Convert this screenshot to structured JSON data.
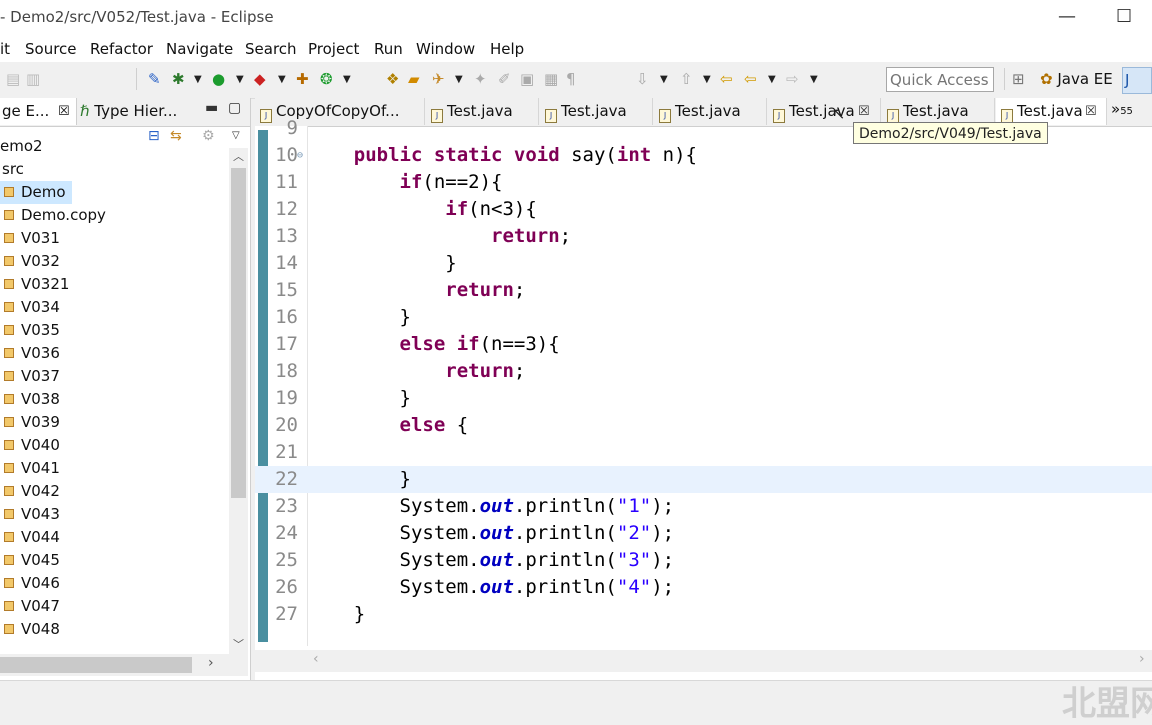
{
  "window": {
    "title": "- Demo2/src/V052/Test.java - Eclipse",
    "minimize_glyph": "—",
    "maximize_glyph": "☐"
  },
  "menubar": {
    "items": [
      "it",
      "Source",
      "Refactor",
      "Navigate",
      "Search",
      "Project",
      "Run",
      "Window",
      "Help"
    ]
  },
  "toolbar": {
    "quick_access_placeholder": "Quick Access",
    "perspective_javaee": "Java EE",
    "perspective_java": "J",
    "icons": [
      "debug-icon",
      "bug-icon",
      "run-icon",
      "coverage-icon",
      "new-class-icon",
      "external-tools-icon",
      "open-type-icon",
      "open-task-icon",
      "search-icon",
      "annotation-icon",
      "back-icon",
      "forward-icon"
    ]
  },
  "left_panel": {
    "tabs": [
      {
        "label": "ge E...",
        "close": "☒"
      },
      {
        "label": "Type Hier..."
      }
    ],
    "tree": [
      {
        "label": "emo2",
        "type": "project"
      },
      {
        "label": "src",
        "type": "folder"
      },
      {
        "label": "Demo",
        "type": "package",
        "selected": true
      },
      {
        "label": "Demo.copy",
        "type": "package"
      },
      {
        "label": "V031",
        "type": "package"
      },
      {
        "label": "V032",
        "type": "package"
      },
      {
        "label": "V0321",
        "type": "package"
      },
      {
        "label": "V034",
        "type": "package"
      },
      {
        "label": "V035",
        "type": "package"
      },
      {
        "label": "V036",
        "type": "package"
      },
      {
        "label": "V037",
        "type": "package"
      },
      {
        "label": "V038",
        "type": "package"
      },
      {
        "label": "V039",
        "type": "package"
      },
      {
        "label": "V040",
        "type": "package"
      },
      {
        "label": "V041",
        "type": "package"
      },
      {
        "label": "V042",
        "type": "package"
      },
      {
        "label": "V043",
        "type": "package"
      },
      {
        "label": "V044",
        "type": "package"
      },
      {
        "label": "V045",
        "type": "package"
      },
      {
        "label": "V046",
        "type": "package"
      },
      {
        "label": "V047",
        "type": "package"
      },
      {
        "label": "V048",
        "type": "package"
      }
    ]
  },
  "editor": {
    "tabs": [
      {
        "label": "CopyOfCopyOf..."
      },
      {
        "label": "Test.java"
      },
      {
        "label": "Test.java"
      },
      {
        "label": "Test.java"
      },
      {
        "label": "Test.java",
        "close": "☒"
      },
      {
        "label": "Test.java"
      },
      {
        "label": "Test.java",
        "close": "☒",
        "active": true
      }
    ],
    "overflow_label": "»",
    "overflow_count": "55",
    "tooltip": "Demo2/src/V049/Test.java",
    "lines": [
      {
        "n": "9",
        "tokens": []
      },
      {
        "n": "10",
        "tokens": [
          {
            "t": "    "
          },
          {
            "t": "public static void",
            "k": "kw"
          },
          {
            "t": " say("
          },
          {
            "t": "int",
            "k": "kw"
          },
          {
            "t": " n){"
          }
        ]
      },
      {
        "n": "11",
        "tokens": [
          {
            "t": "        "
          },
          {
            "t": "if",
            "k": "kw"
          },
          {
            "t": "(n==2){"
          }
        ]
      },
      {
        "n": "12",
        "tokens": [
          {
            "t": "            "
          },
          {
            "t": "if",
            "k": "kw"
          },
          {
            "t": "(n<3){"
          }
        ]
      },
      {
        "n": "13",
        "tokens": [
          {
            "t": "                "
          },
          {
            "t": "return",
            "k": "kw"
          },
          {
            "t": ";"
          }
        ]
      },
      {
        "n": "14",
        "tokens": [
          {
            "t": "            }"
          }
        ]
      },
      {
        "n": "15",
        "tokens": [
          {
            "t": "            "
          },
          {
            "t": "return",
            "k": "kw"
          },
          {
            "t": ";"
          }
        ]
      },
      {
        "n": "16",
        "tokens": [
          {
            "t": "        }"
          }
        ]
      },
      {
        "n": "17",
        "tokens": [
          {
            "t": "        "
          },
          {
            "t": "else if",
            "k": "kw"
          },
          {
            "t": "(n==3){"
          }
        ]
      },
      {
        "n": "18",
        "tokens": [
          {
            "t": "            "
          },
          {
            "t": "return",
            "k": "kw"
          },
          {
            "t": ";"
          }
        ]
      },
      {
        "n": "19",
        "tokens": [
          {
            "t": "        }"
          }
        ]
      },
      {
        "n": "20",
        "tokens": [
          {
            "t": "        "
          },
          {
            "t": "else",
            "k": "kw"
          },
          {
            "t": " {"
          }
        ]
      },
      {
        "n": "21",
        "tokens": []
      },
      {
        "n": "22",
        "tokens": [
          {
            "t": "        }"
          }
        ],
        "current": true
      },
      {
        "n": "23",
        "tokens": [
          {
            "t": "        System."
          },
          {
            "t": "out",
            "k": "fld"
          },
          {
            "t": ".println("
          },
          {
            "t": "\"1\"",
            "k": "str"
          },
          {
            "t": ");"
          }
        ]
      },
      {
        "n": "24",
        "tokens": [
          {
            "t": "        System."
          },
          {
            "t": "out",
            "k": "fld"
          },
          {
            "t": ".println("
          },
          {
            "t": "\"2\"",
            "k": "str"
          },
          {
            "t": ");"
          }
        ]
      },
      {
        "n": "25",
        "tokens": [
          {
            "t": "        System."
          },
          {
            "t": "out",
            "k": "fld"
          },
          {
            "t": ".println("
          },
          {
            "t": "\"3\"",
            "k": "str"
          },
          {
            "t": ");"
          }
        ]
      },
      {
        "n": "26",
        "tokens": [
          {
            "t": "        System."
          },
          {
            "t": "out",
            "k": "fld"
          },
          {
            "t": ".println("
          },
          {
            "t": "\"4\"",
            "k": "str"
          },
          {
            "t": ");"
          }
        ]
      },
      {
        "n": "27",
        "tokens": [
          {
            "t": "    }"
          }
        ]
      }
    ]
  },
  "watermark": "北盟网"
}
